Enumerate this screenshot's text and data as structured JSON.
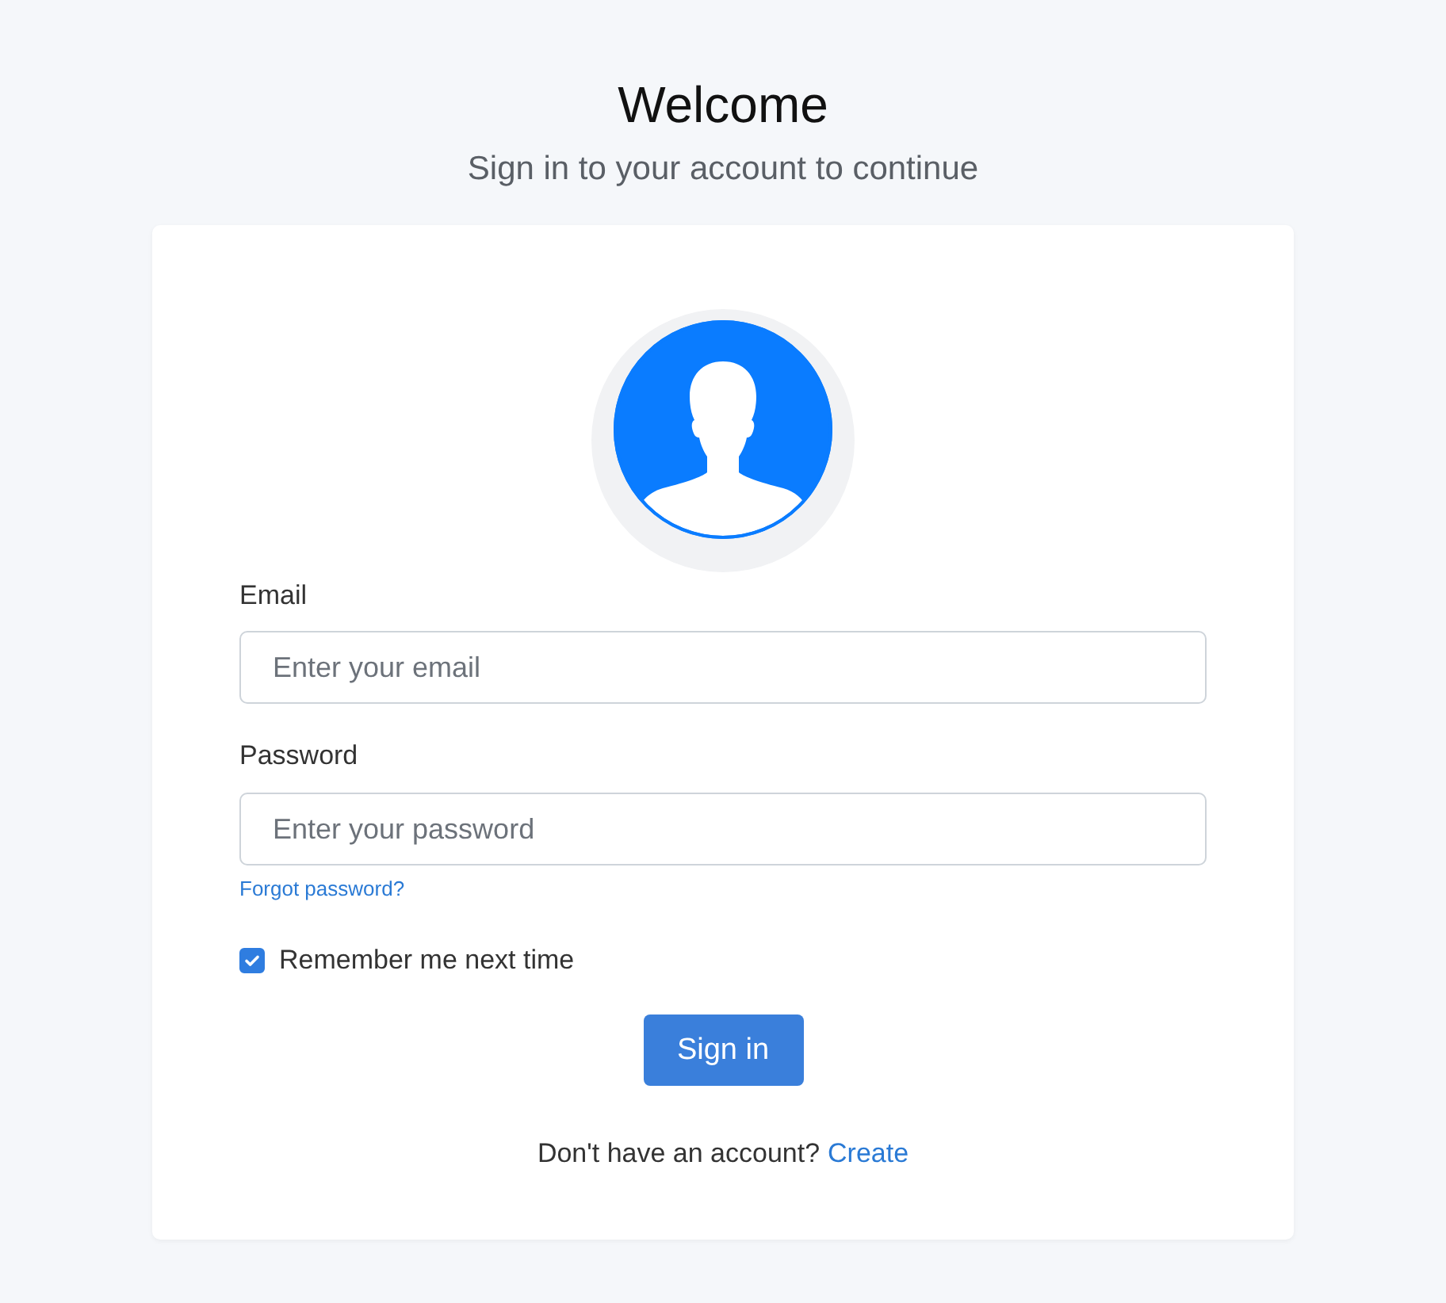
{
  "header": {
    "title": "Welcome",
    "subtitle": "Sign in to your account to continue"
  },
  "form": {
    "email": {
      "label": "Email",
      "placeholder": "Enter your email"
    },
    "password": {
      "label": "Password",
      "placeholder": "Enter your password"
    },
    "forgot_link": "Forgot password?",
    "remember": {
      "label": "Remember me next time",
      "checked": true
    },
    "submit": "Sign in",
    "footer": {
      "text": "Don't have an account?",
      "link": "Create"
    }
  }
}
